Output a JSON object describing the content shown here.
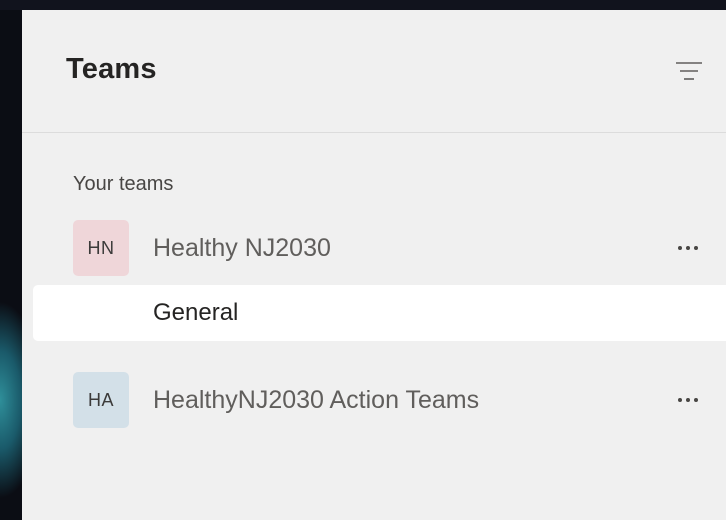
{
  "panel": {
    "title": "Teams"
  },
  "section": {
    "label": "Your teams"
  },
  "teams": [
    {
      "initials": "HN",
      "name": "Healthy NJ2030",
      "avatar_color": "#efd6d9",
      "channels": [
        {
          "name": "General",
          "selected": true
        }
      ]
    },
    {
      "initials": "HA",
      "name": "HealthyNJ2030 Action Teams",
      "avatar_color": "#d3e0e8",
      "channels": []
    }
  ],
  "icons": {
    "filter": "filter-icon",
    "more": "more-options-icon"
  },
  "colors": {
    "panel_bg": "#f0f0f0",
    "selected_row_bg": "#ffffff",
    "title_text": "#252423",
    "secondary_text": "#605e5c"
  }
}
